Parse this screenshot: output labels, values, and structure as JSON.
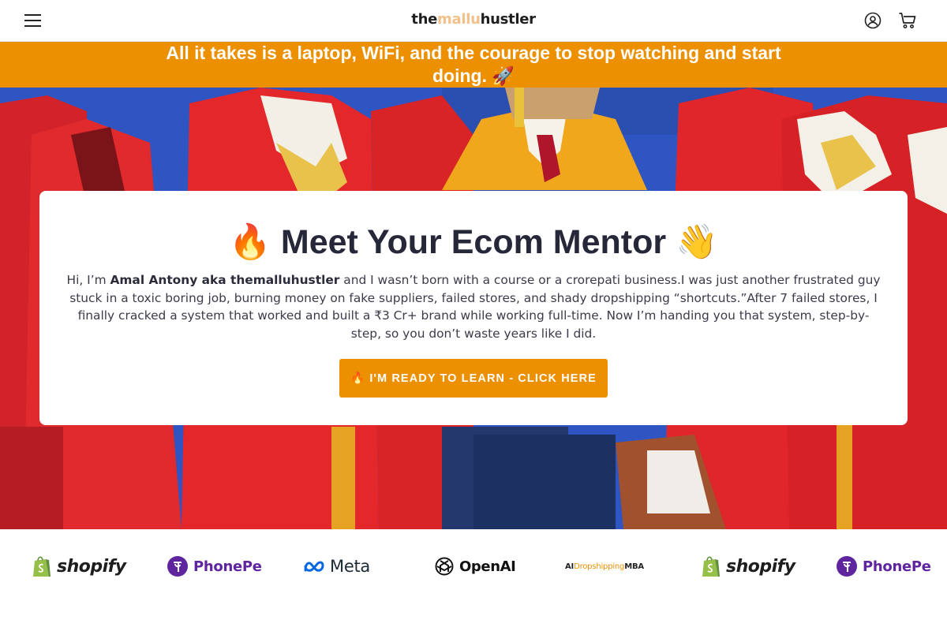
{
  "header": {
    "logo": {
      "part1": "the",
      "part2": "mallu",
      "part3": "hustler"
    },
    "icons": [
      "menu-icon",
      "account-icon",
      "cart-icon"
    ]
  },
  "announcement": {
    "text": "All it takes is a laptop, WiFi, and the courage to stop watching and start doing. 🚀"
  },
  "card": {
    "title": "🔥 Meet Your Ecom Mentor 👋",
    "intro_pre": "Hi, I’m ",
    "intro_name": "Amal Antony aka themalluhustler",
    "intro_post": " and I wasn’t born with a course or a crorepati business.I was just another frustrated guy stuck in a toxic boring job, burning money on fake suppliers, failed stores, and shady dropshipping “shortcuts.”After 7 failed stores, I finally cracked a system that worked and built a ₹3 Cr+ brand while working full-time. Now I’m handing you that system, step-by-step, so you don’t waste years like I did.",
    "cta_label": "🔥 I'M READY TO LEARN - CLICK HERE"
  },
  "brands": [
    {
      "name": "shopify",
      "icon": "shopify-bag-icon"
    },
    {
      "name": "PhonePe",
      "icon": "phonepe-icon"
    },
    {
      "name": "Meta",
      "icon": "meta-infinity-icon"
    },
    {
      "name": "OpenAI",
      "icon": "openai-knot-icon"
    },
    {
      "name_pre": "AI",
      "name_accent": "Dropshipping",
      "name_post": "MBA"
    },
    {
      "name": "shopify",
      "icon": "shopify-bag-icon"
    },
    {
      "name": "PhonePe",
      "icon": "phonepe-icon"
    }
  ],
  "colors": {
    "accent": "#ec9000",
    "logo_highlight": "#f2c08a",
    "phonepe": "#5f259f",
    "shopify_green": "#95bf47",
    "meta_blue": "#0668e1"
  }
}
